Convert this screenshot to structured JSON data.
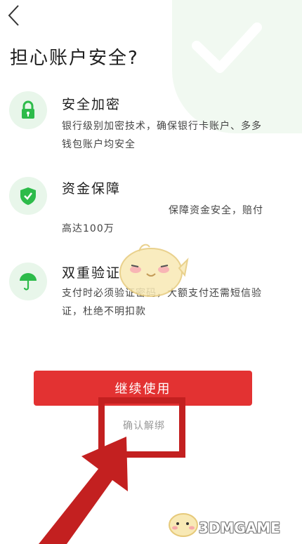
{
  "header": {
    "back_icon": "chevron-left-icon",
    "title": "担心账户安全?"
  },
  "features": [
    {
      "icon": "lock-icon",
      "title": "安全加密",
      "desc_line1": "银行级别加密技术，确保银行卡账户、多多",
      "desc_line2": "钱包账户均安全"
    },
    {
      "icon": "shield-check-icon",
      "title": "资金保障",
      "desc_line1": "保障资金安全，赔付",
      "desc_line2": "高达100万"
    },
    {
      "icon": "umbrella-icon",
      "title": "双重验证",
      "desc_line1": "支付时必须验证密码，大额支付还需短信验",
      "desc_line2": "证，杜绝不明扣款"
    }
  ],
  "actions": {
    "continue_label": "继续使用",
    "unbind_label": "确认解绑"
  },
  "watermark": {
    "brand": "3DMGAME"
  },
  "colors": {
    "accent_red": "#e33232",
    "icon_green": "#2dbb4a",
    "icon_bg": "#e8f6ea",
    "annotation_red": "#c32020"
  }
}
